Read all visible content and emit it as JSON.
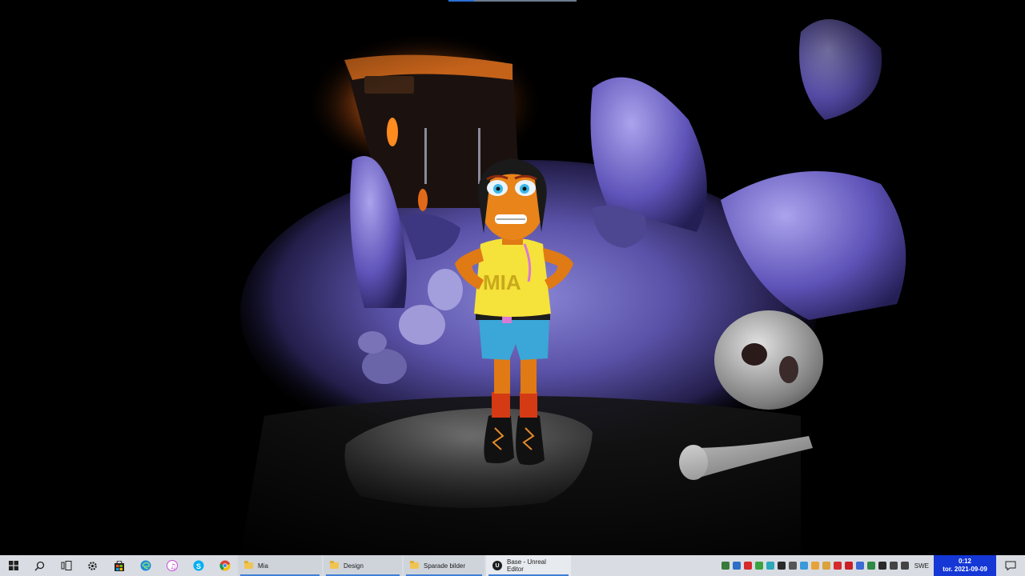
{
  "scene": {
    "shirt_text": "MIA"
  },
  "taskbar": {
    "pinned": [
      {
        "name": "start-button",
        "icon": "windows-icon"
      },
      {
        "name": "search-button",
        "icon": "search-icon"
      },
      {
        "name": "task-view-button",
        "icon": "task-view-icon"
      },
      {
        "name": "settings-button",
        "icon": "gear-icon"
      },
      {
        "name": "store-button",
        "icon": "store-icon"
      },
      {
        "name": "edge-button",
        "icon": "edge-icon"
      },
      {
        "name": "itunes-button",
        "icon": "music-icon"
      },
      {
        "name": "skype-button",
        "icon": "skype-icon"
      },
      {
        "name": "chrome-button",
        "icon": "chrome-icon"
      }
    ],
    "apps": [
      {
        "label": "Mia"
      },
      {
        "label": "Design"
      },
      {
        "label": "Sparade bilder"
      },
      {
        "label": "Base - Unreal Editor"
      }
    ],
    "tray_colors": [
      "#3a7a3a",
      "#2d6ec7",
      "#d42c2c",
      "#3aa341",
      "#2aa9b8",
      "#2a2a2a",
      "#555555",
      "#3a9ad9",
      "#e8a23a",
      "#d9a23a",
      "#d42c2c",
      "#c91f26",
      "#3c6bd6",
      "#2e8a44",
      "#2a2a2a",
      "#444444",
      "#444444"
    ],
    "language": "SWE",
    "clock_time": "0:12",
    "clock_date": "tor. 2021-09-09"
  }
}
